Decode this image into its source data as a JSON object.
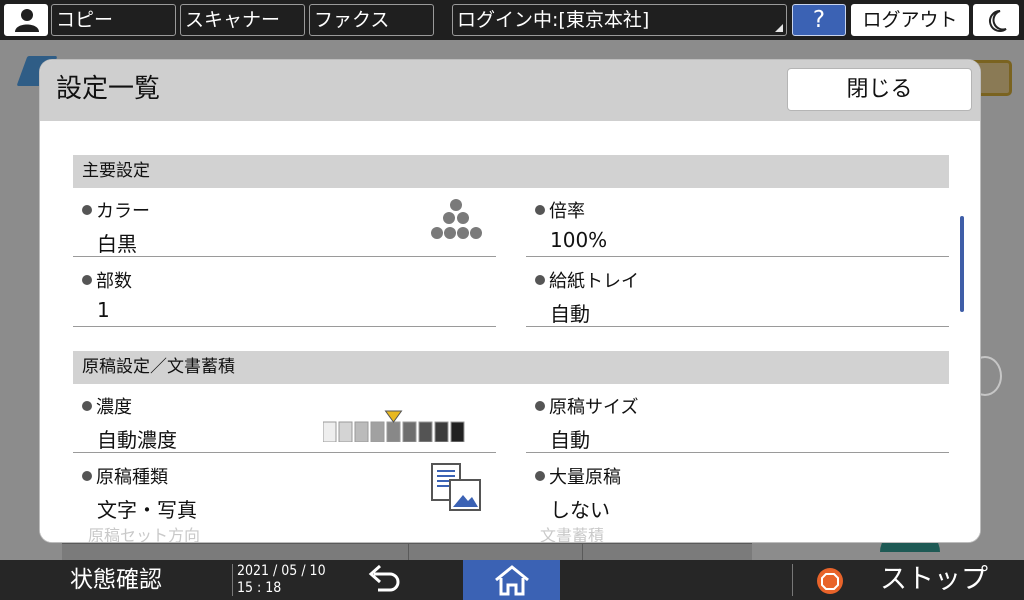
{
  "topbar": {
    "copy": "コピー",
    "scanner": "スキャナー",
    "fax": "ファクス",
    "login_status": "ログイン中:[東京本社]",
    "help": "?",
    "logout": "ログアウト"
  },
  "dialog": {
    "title": "設定一覧",
    "close_label": "閉じる",
    "sections": [
      {
        "title": "主要設定",
        "items": [
          {
            "label": "カラー",
            "value": "白黒",
            "icon": "toner-dots-icon"
          },
          {
            "label": "倍率",
            "value": "100%"
          },
          {
            "label": "部数",
            "value": "1"
          },
          {
            "label": "給紙トレイ",
            "value": "自動"
          }
        ]
      },
      {
        "title": "原稿設定／文書蓄積",
        "items": [
          {
            "label": "濃度",
            "value": "自動濃度",
            "icon": "density-scale-icon",
            "density_level": 5,
            "density_steps": 9
          },
          {
            "label": "原稿サイズ",
            "value": "自動"
          },
          {
            "label": "原稿種類",
            "value": "文字・写真",
            "icon": "text-photo-icon"
          },
          {
            "label": "大量原稿",
            "value": "しない"
          }
        ]
      }
    ],
    "partial_left": "原稿セット方向",
    "partial_right": "文書蓄積"
  },
  "bottombar": {
    "status_check": "状態確認",
    "date": "2021 / 05 / 10",
    "time": "15 : 18",
    "stop_label": "ストップ"
  },
  "colors": {
    "accent_blue": "#3b62b4",
    "section_gray": "#d2d2d2",
    "stop_orange": "#e8632a"
  }
}
